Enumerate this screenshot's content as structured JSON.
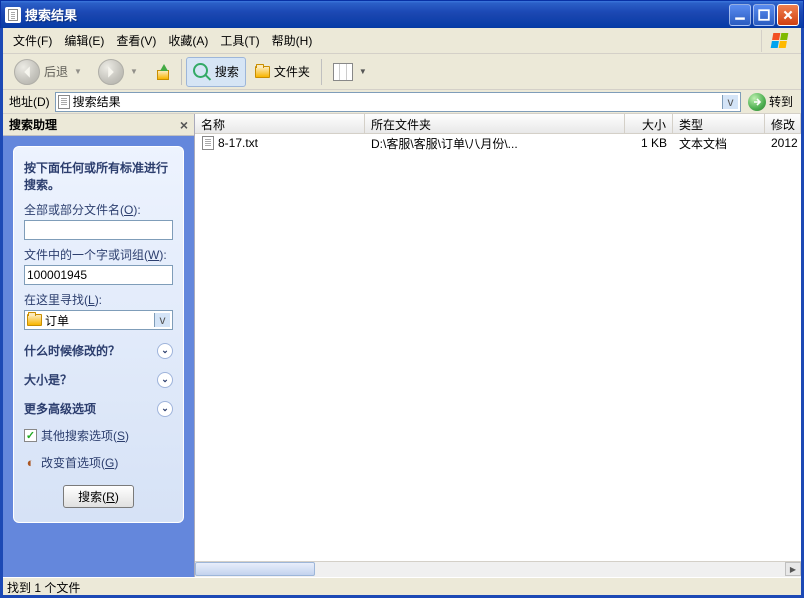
{
  "titlebar": {
    "title": "搜索结果"
  },
  "menu": {
    "file": "文件(F)",
    "edit": "编辑(E)",
    "view": "查看(V)",
    "favorites": "收藏(A)",
    "tools": "工具(T)",
    "help": "帮助(H)"
  },
  "toolbar": {
    "back": "后退",
    "search": "搜索",
    "folders": "文件夹"
  },
  "addressbar": {
    "label": "地址(D)",
    "value": "搜索结果",
    "go": "转到"
  },
  "sidebar": {
    "title": "搜索助理",
    "panel_header": "按下面任何或所有标准进行搜索。",
    "filename_label_pre": "全部或部分文件名(",
    "filename_label_u": "O",
    "filename_label_post": "):",
    "filename_value": "",
    "content_label_pre": "文件中的一个字或词组(",
    "content_label_u": "W",
    "content_label_post": "):",
    "content_value": "100001945",
    "lookin_label_pre": "在这里寻找(",
    "lookin_label_u": "L",
    "lookin_label_post": "):",
    "lookin_value": "订单",
    "expander_when": "什么时候修改的？",
    "expander_size": "大小是？",
    "expander_more": "更多高级选项",
    "link_other_pre": "其他搜索选项(",
    "link_other_u": "S",
    "link_other_post": ")",
    "link_prefs_pre": "改变首选项(",
    "link_prefs_u": "G",
    "link_prefs_post": ")",
    "search_btn_pre": "搜索(",
    "search_btn_u": "R",
    "search_btn_post": ")"
  },
  "columns": {
    "name": "名称",
    "folder": "所在文件夹",
    "size": "大小",
    "type": "类型",
    "date": "修改"
  },
  "rows": [
    {
      "name": "8-17.txt",
      "folder": "D:\\客服\\客服\\订单\\八月份\\...",
      "size": "1 KB",
      "type": "文本文档",
      "date": "2012"
    }
  ],
  "status": "找到 1 个文件"
}
